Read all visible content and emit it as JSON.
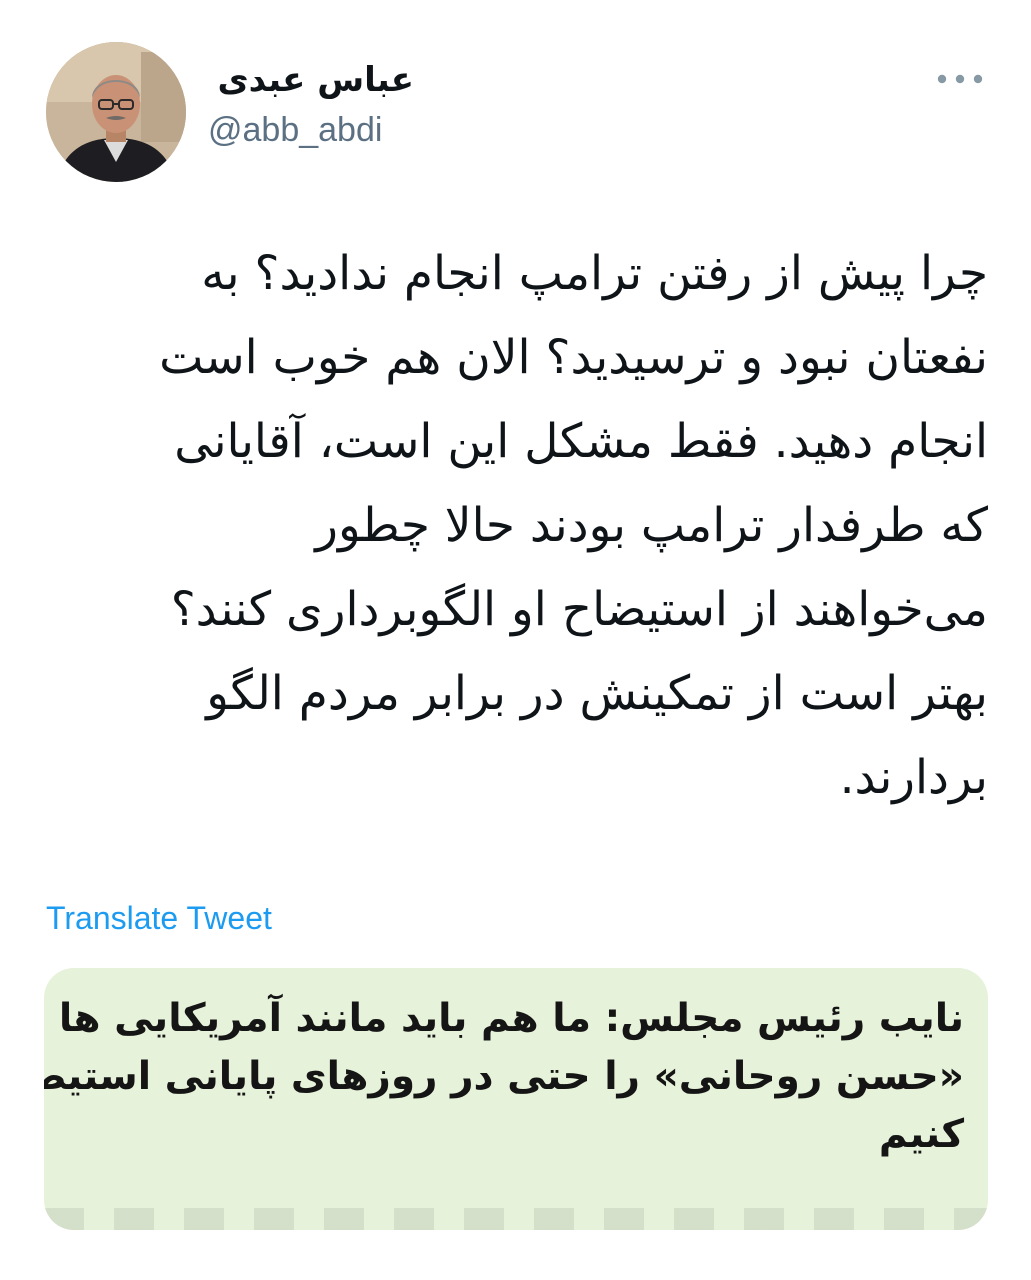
{
  "author": {
    "display_name": "عباس عبدی",
    "handle": "@abb_abdi"
  },
  "icons": {
    "more": "more-horizontal-icon",
    "avatar": "profile-photo"
  },
  "tweet": {
    "lines": [
      "چرا پیش از رفتن ترامپ انجام ندادید؟ به",
      "نفعتان نبود و ترسیدید؟ الان هم خوب است",
      "انجام دهید. فقط مشکل این است، آقایانی",
      "که طرفدار ترامپ بودند حالا چطور",
      "می‌خواهند از استیضاح او الگوبرداری کنند؟",
      "بهتر است از تمکینش در برابر مردم الگو",
      "بردارند."
    ],
    "translate_label": "Translate Tweet"
  },
  "media": {
    "lines": [
      "نایب رئیس مجلس: ما هم باید مانند آمریکایی ها",
      "«حسن روحانی» را حتی در روزهای پایانی استیضاح",
      "کنیم"
    ]
  },
  "colors": {
    "link": "#1d9bf0",
    "handle": "#5b7083",
    "media_background": "#e6f2d9"
  }
}
